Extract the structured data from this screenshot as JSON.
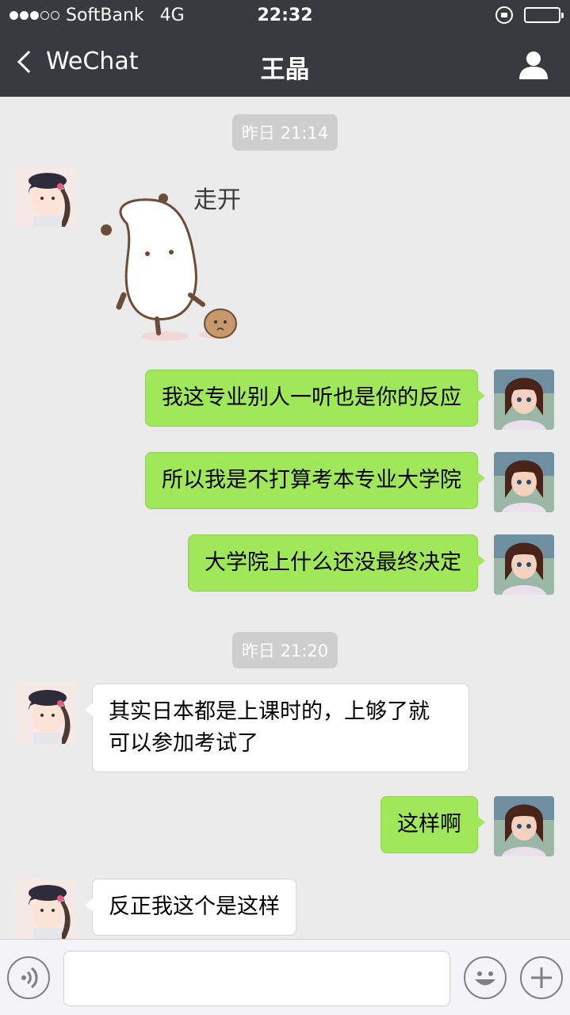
{
  "status_bar": {
    "carrier": "SoftBank",
    "network": "4G",
    "time": "22:32",
    "signal_bars": 3,
    "signal_max": 5,
    "battery_level": 1.0
  },
  "nav": {
    "back_label": "WeChat",
    "title": "王晶"
  },
  "messages": [
    {
      "type": "timestamp",
      "text": "昨日 21:14"
    },
    {
      "type": "sticker",
      "sender": "them",
      "sticker_text": "走开"
    },
    {
      "type": "text",
      "sender": "me",
      "text": "我这专业别人一听也是你的反应"
    },
    {
      "type": "text",
      "sender": "me",
      "text": "所以我是不打算考本专业大学院"
    },
    {
      "type": "text",
      "sender": "me",
      "text": "大学院上什么还没最终决定"
    },
    {
      "type": "timestamp",
      "text": "昨日 21:20"
    },
    {
      "type": "text",
      "sender": "them",
      "line1": "其实日本都是上课时的，上够了就",
      "line2": "可以参加考试了"
    },
    {
      "type": "text",
      "sender": "me",
      "text": "这样啊"
    },
    {
      "type": "text",
      "sender": "them",
      "text": "反正我这个是这样"
    }
  ],
  "input": {
    "placeholder": ""
  },
  "colors": {
    "header_bg": "#393a3f",
    "chat_bg": "#ebebeb",
    "my_bubble": "#a0e75a",
    "their_bubble": "#ffffff"
  },
  "icons": [
    "chevron-left-icon",
    "person-icon",
    "lock-rotation-icon",
    "battery-icon",
    "voice-icon",
    "emoji-icon",
    "plus-icon"
  ]
}
